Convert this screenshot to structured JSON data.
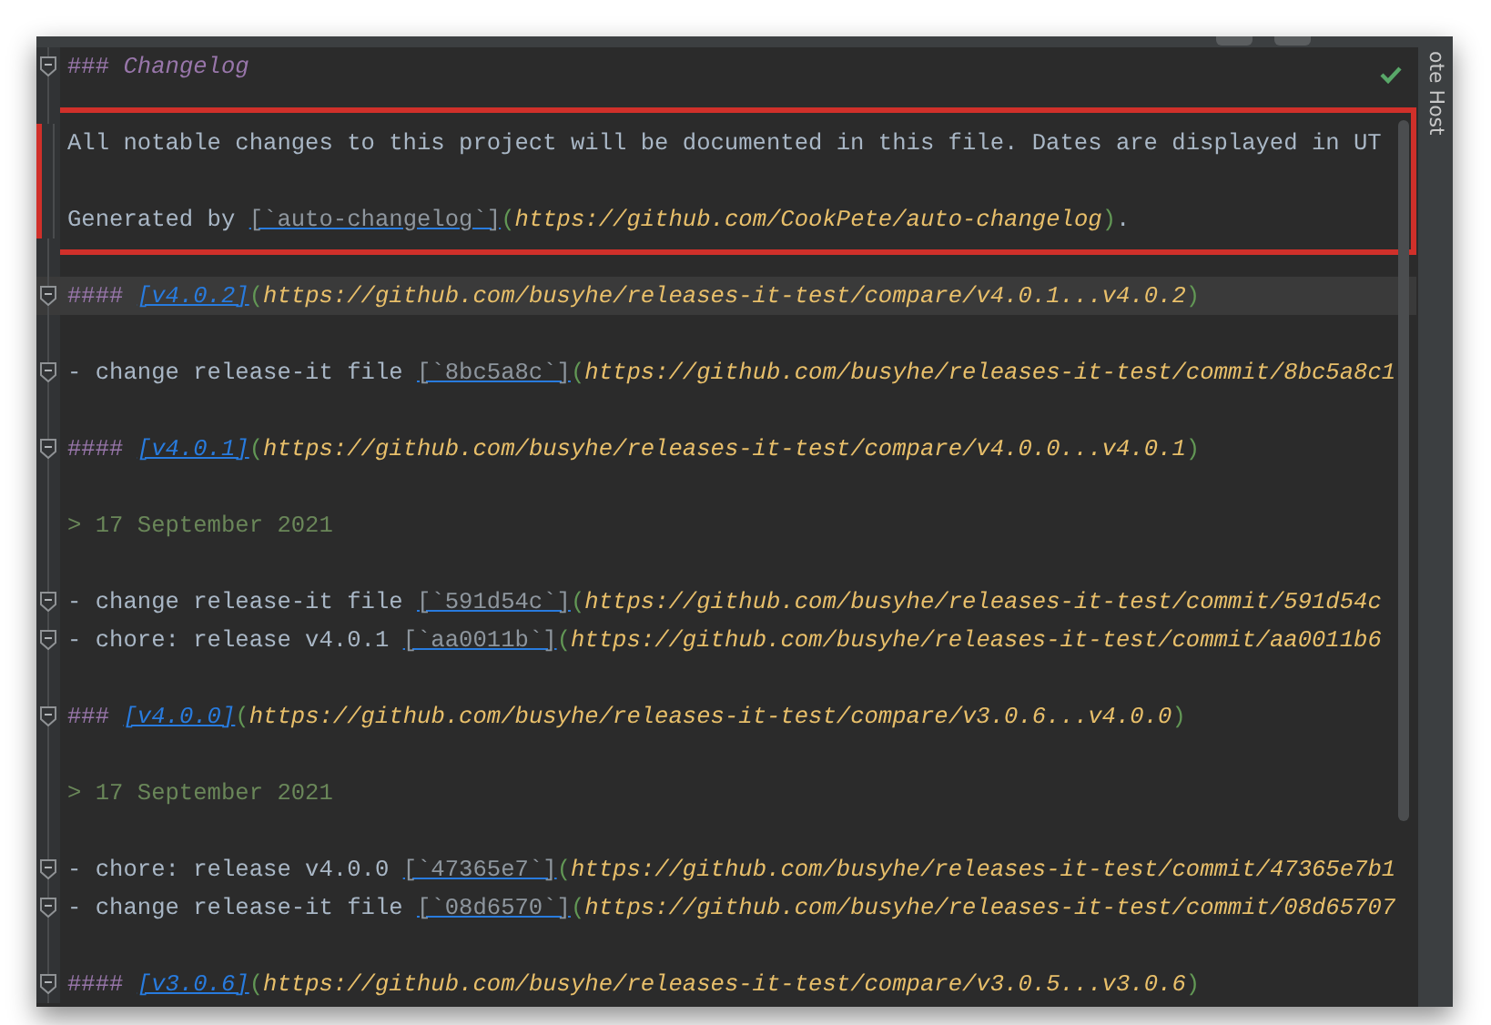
{
  "side_panel": {
    "label": "ote Host"
  },
  "editor": {
    "lines": [
      {
        "kind": "code",
        "foldable": true,
        "current": false,
        "boxed": false,
        "parts": [
          {
            "kind": "marker",
            "text": "###"
          },
          {
            "kind": "heading",
            "text": "Changelog"
          }
        ]
      },
      {
        "kind": "blank",
        "foldable": false,
        "current": false,
        "boxed": false
      },
      {
        "kind": "code",
        "foldable": false,
        "current": false,
        "boxed": true,
        "parts": [
          {
            "kind": "plain",
            "text": "All notable changes to this project will be documented in this file. Dates are displayed in UT"
          }
        ]
      },
      {
        "kind": "blank",
        "foldable": false,
        "current": false,
        "boxed": true
      },
      {
        "kind": "code",
        "foldable": false,
        "current": false,
        "boxed": true,
        "parts": [
          {
            "kind": "plain",
            "text": "Generated by"
          },
          {
            "kind": "code_link",
            "text": "[`auto-changelog`]"
          },
          {
            "kind": "paren",
            "text": "("
          },
          {
            "kind": "url",
            "text": "https://github.com/CookPete/auto-changelog"
          },
          {
            "kind": "paren",
            "text": ")"
          },
          {
            "kind": "plain",
            "text": "."
          }
        ]
      },
      {
        "kind": "blank",
        "foldable": false,
        "current": false,
        "boxed": false
      },
      {
        "kind": "code",
        "foldable": true,
        "current": true,
        "boxed": false,
        "parts": [
          {
            "kind": "marker",
            "text": "####"
          },
          {
            "kind": "link",
            "text": "[v4.0.2]"
          },
          {
            "kind": "paren",
            "text": "("
          },
          {
            "kind": "url",
            "text": "https://github.com/busyhe/releases-it-test/compare/v4.0.1...v4.0.2"
          },
          {
            "kind": "paren",
            "text": ")"
          }
        ]
      },
      {
        "kind": "blank",
        "foldable": false,
        "current": false,
        "boxed": false
      },
      {
        "kind": "code",
        "foldable": true,
        "current": false,
        "boxed": false,
        "parts": [
          {
            "kind": "plain",
            "text": "- change release-it file"
          },
          {
            "kind": "code_link",
            "text": "[`8bc5a8c`]"
          },
          {
            "kind": "paren",
            "text": "("
          },
          {
            "kind": "url",
            "text": "https://github.com/busyhe/releases-it-test/commit/8bc5a8c1"
          }
        ]
      },
      {
        "kind": "blank",
        "foldable": false,
        "current": false,
        "boxed": false
      },
      {
        "kind": "code",
        "foldable": true,
        "current": false,
        "boxed": false,
        "parts": [
          {
            "kind": "marker",
            "text": "####"
          },
          {
            "kind": "link",
            "text": "[v4.0.1]"
          },
          {
            "kind": "paren",
            "text": "("
          },
          {
            "kind": "url",
            "text": "https://github.com/busyhe/releases-it-test/compare/v4.0.0...v4.0.1"
          },
          {
            "kind": "paren",
            "text": ")"
          }
        ]
      },
      {
        "kind": "blank",
        "foldable": false,
        "current": false,
        "boxed": false
      },
      {
        "kind": "code",
        "foldable": false,
        "current": false,
        "boxed": false,
        "parts": [
          {
            "kind": "quote",
            "text": "> 17 September 2021"
          }
        ]
      },
      {
        "kind": "blank",
        "foldable": false,
        "current": false,
        "boxed": false
      },
      {
        "kind": "code",
        "foldable": true,
        "current": false,
        "boxed": false,
        "parts": [
          {
            "kind": "plain",
            "text": "- change release-it file"
          },
          {
            "kind": "code_link",
            "text": "[`591d54c`]"
          },
          {
            "kind": "paren",
            "text": "("
          },
          {
            "kind": "url",
            "text": "https://github.com/busyhe/releases-it-test/commit/591d54c"
          }
        ]
      },
      {
        "kind": "code",
        "foldable": true,
        "current": false,
        "boxed": false,
        "parts": [
          {
            "kind": "plain",
            "text": "- chore: release v4.0.1"
          },
          {
            "kind": "code_link",
            "text": "[`aa0011b`]"
          },
          {
            "kind": "paren",
            "text": "("
          },
          {
            "kind": "url",
            "text": "https://github.com/busyhe/releases-it-test/commit/aa0011b6"
          }
        ]
      },
      {
        "kind": "blank",
        "foldable": false,
        "current": false,
        "boxed": false
      },
      {
        "kind": "code",
        "foldable": true,
        "current": false,
        "boxed": false,
        "parts": [
          {
            "kind": "marker",
            "text": "###"
          },
          {
            "kind": "link",
            "text": "[v4.0.0]"
          },
          {
            "kind": "paren",
            "text": "("
          },
          {
            "kind": "url",
            "text": "https://github.com/busyhe/releases-it-test/compare/v3.0.6...v4.0.0"
          },
          {
            "kind": "paren",
            "text": ")"
          }
        ]
      },
      {
        "kind": "blank",
        "foldable": false,
        "current": false,
        "boxed": false
      },
      {
        "kind": "code",
        "foldable": false,
        "current": false,
        "boxed": false,
        "parts": [
          {
            "kind": "quote",
            "text": "> 17 September 2021"
          }
        ]
      },
      {
        "kind": "blank",
        "foldable": false,
        "current": false,
        "boxed": false
      },
      {
        "kind": "code",
        "foldable": true,
        "current": false,
        "boxed": false,
        "parts": [
          {
            "kind": "plain",
            "text": "- chore: release v4.0.0"
          },
          {
            "kind": "code_link",
            "text": "[`47365e7`]"
          },
          {
            "kind": "paren",
            "text": "("
          },
          {
            "kind": "url",
            "text": "https://github.com/busyhe/releases-it-test/commit/47365e7b1"
          }
        ]
      },
      {
        "kind": "code",
        "foldable": true,
        "current": false,
        "boxed": false,
        "parts": [
          {
            "kind": "plain",
            "text": "- change release-it file"
          },
          {
            "kind": "code_link",
            "text": "[`08d6570`]"
          },
          {
            "kind": "paren",
            "text": "("
          },
          {
            "kind": "url",
            "text": "https://github.com/busyhe/releases-it-test/commit/08d65707"
          }
        ]
      },
      {
        "kind": "blank",
        "foldable": false,
        "current": false,
        "boxed": false
      },
      {
        "kind": "code",
        "foldable": true,
        "current": false,
        "boxed": false,
        "parts": [
          {
            "kind": "marker",
            "text": "####"
          },
          {
            "kind": "link",
            "text": "[v3.0.6]"
          },
          {
            "kind": "paren",
            "text": "("
          },
          {
            "kind": "url",
            "text": "https://github.com/busyhe/releases-it-test/compare/v3.0.5...v3.0.6"
          },
          {
            "kind": "paren",
            "text": ")"
          }
        ]
      }
    ]
  }
}
